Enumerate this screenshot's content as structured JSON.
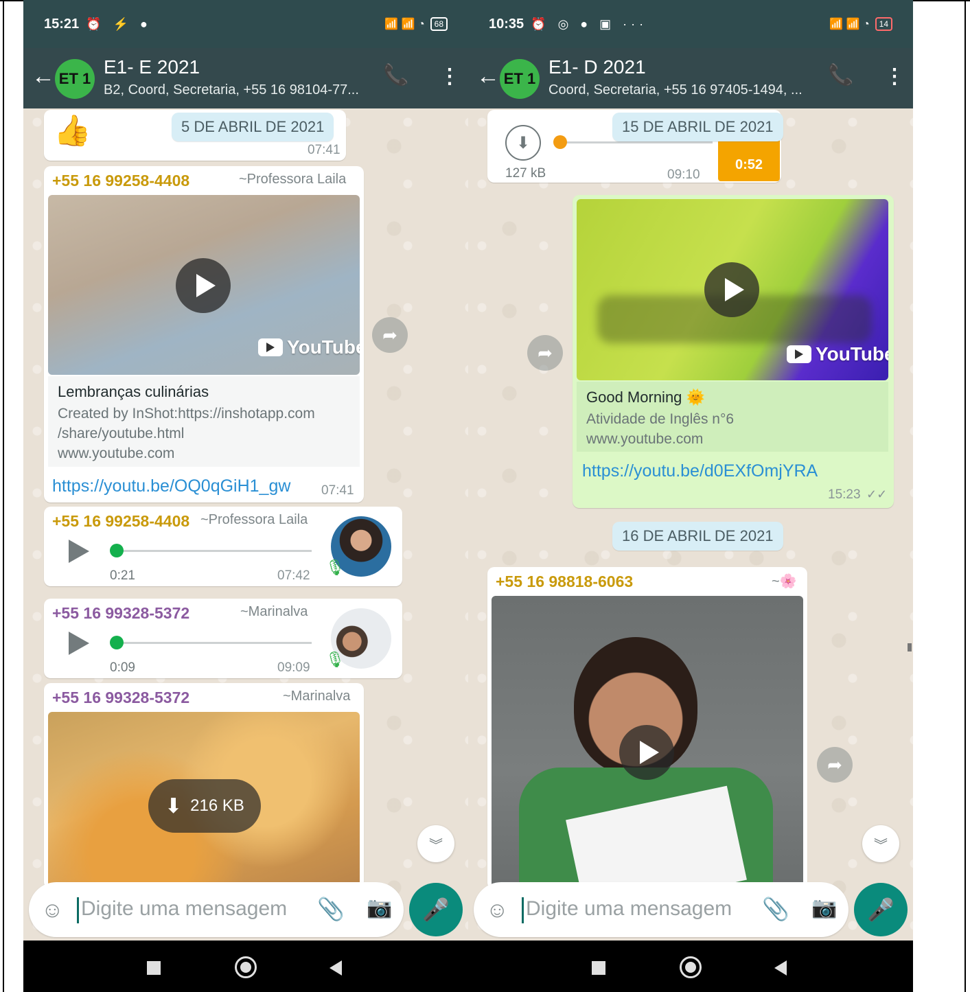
{
  "left": {
    "status": {
      "time": "15:21",
      "icons": "⏰ ⚡ ●",
      "signal": "📶 📶 ◔",
      "battery": "68"
    },
    "header": {
      "avatar": "ET 1",
      "title": "E1- E 2021",
      "subtitle": "B2, Coord, Secretaria, +55 16 98104-77..."
    },
    "date_pill": "5 DE ABRIL DE 2021",
    "top_ts": "07:41",
    "thumbs_emoji": "👍",
    "video_msg": {
      "sender": "+55 16 99258-4408",
      "name": "~Professora Laila",
      "yt": "YouTube",
      "card_title": "Lembranças culinárias",
      "card_lines": [
        "Created by InShot:https://inshotapp.com",
        "/share/youtube.html",
        "www.youtube.com"
      ],
      "link": "https://youtu.be/OQ0qGiH1_gw",
      "ts": "07:41"
    },
    "voice1": {
      "sender": "+55 16 99258-4408",
      "name": "~Professora Laila",
      "dur": "0:21",
      "ts": "07:42"
    },
    "voice2": {
      "sender": "+55 16 99328-5372",
      "name": "~Marinalva",
      "dur": "0:09",
      "ts": "09:09"
    },
    "image_msg": {
      "sender": "+55 16 99328-5372",
      "name": "~Marinalva",
      "size": "216 KB"
    },
    "input_placeholder": "Digite uma mensagem"
  },
  "right": {
    "status": {
      "time": "10:35",
      "icons": "⏰ ◎ ● ▣ ···",
      "signal": "📶 📶 ◔",
      "battery": "14"
    },
    "header": {
      "avatar": "ET 1",
      "title": "E1- D 2021",
      "subtitle": "Coord, Secretaria, +55 16 97405-1494, ..."
    },
    "audio_msg": {
      "size": "127 kB",
      "ts": "09:10",
      "dur": "0:52"
    },
    "date_pill_1": "15 DE ABRIL DE 2021",
    "video_msg": {
      "yt": "YouTube",
      "card_title": "Good Morning 🌞",
      "card_lines": [
        "Atividade de Inglês n°6",
        "www.youtube.com"
      ],
      "link": "https://youtu.be/d0EXfOmjYRA",
      "ts": "15:23",
      "ticks": "✓✓"
    },
    "date_pill_2": "16 DE ABRIL DE 2021",
    "photo_msg": {
      "sender": "+55 16 98818-6063",
      "name": "~🌸"
    },
    "input_placeholder": "Digite uma mensagem"
  },
  "colors": {
    "header": "#34494d",
    "accent": "#0a8b7c",
    "sender_gold": "#c99a0b",
    "sender_purple": "#8b5aa0",
    "link": "#2a8fd4"
  }
}
